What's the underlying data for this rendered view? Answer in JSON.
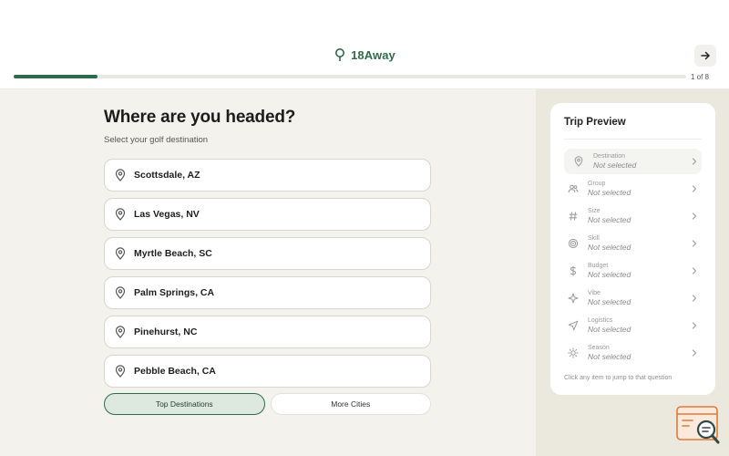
{
  "header": {
    "brand": "18Away",
    "step_label": "1 of 8",
    "progress_fraction": 0.125,
    "accent_color": "#2e6b4a"
  },
  "main": {
    "title": "Where are you headed?",
    "subtitle": "Select your golf destination",
    "destinations": [
      {
        "label": "Scottsdale, AZ",
        "icon": "map-pin-icon"
      },
      {
        "label": "Las Vegas, NV",
        "icon": "map-pin-icon"
      },
      {
        "label": "Myrtle Beach, SC",
        "icon": "map-pin-icon"
      },
      {
        "label": "Palm Springs, CA",
        "icon": "map-pin-icon"
      },
      {
        "label": "Pinehurst, NC",
        "icon": "map-pin-icon"
      },
      {
        "label": "Pebble Beach, CA",
        "icon": "map-pin-icon"
      }
    ],
    "tabs": [
      {
        "label": "Top Destinations",
        "active": true
      },
      {
        "label": "More Cities",
        "active": false
      }
    ]
  },
  "sidebar": {
    "title": "Trip Preview",
    "items": [
      {
        "label": "Destination",
        "value": "Not selected",
        "icon": "map-pin-icon"
      },
      {
        "label": "Group",
        "value": "Not selected",
        "icon": "users-icon"
      },
      {
        "label": "Size",
        "value": "Not selected",
        "icon": "hash-icon"
      },
      {
        "label": "Skill",
        "value": "Not selected",
        "icon": "target-icon"
      },
      {
        "label": "Budget",
        "value": "Not selected",
        "icon": "dollar-icon"
      },
      {
        "label": "Vibe",
        "value": "Not selected",
        "icon": "sparkle-icon"
      },
      {
        "label": "Logistics",
        "value": "Not selected",
        "icon": "navigation-icon"
      },
      {
        "label": "Season",
        "value": "Not selected",
        "icon": "sun-icon"
      }
    ],
    "hint": "Click any item to jump to that question"
  }
}
